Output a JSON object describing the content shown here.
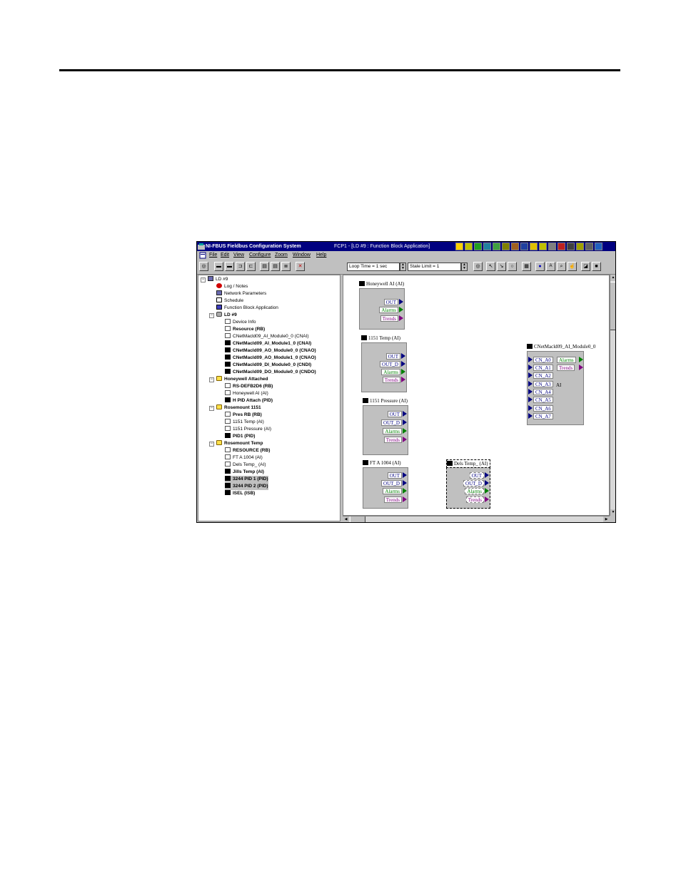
{
  "window": {
    "app_title": "NI-FBUS Fieldbus Configuration System",
    "doc_title": "FCP1 - [LD #9 : Function Block Application]"
  },
  "menu": [
    "File",
    "Edit",
    "View",
    "Configure",
    "Zoom",
    "Window",
    "Help"
  ],
  "toolbar": {
    "loop_time": "Loop Time = 1 sec",
    "stale_limit": "Stale Limit = 1"
  },
  "tree": {
    "root": "LD #9",
    "items": [
      "Log / Notes",
      "Network Parameters",
      "Schedule",
      "Function Block Application",
      "LD #9",
      "Device Info",
      "Resource (RB)",
      "CNetMacld09_AI_Module0_0 (CNAI)",
      "CNetMacld09_AI_Module1_0 (CNAI)",
      "CNetMacld09_AO_Module0_0 (CNAO)",
      "CNetMacld09_AO_Module1_0 (CNAO)",
      "CNetMacld09_DI_Module0_0 (CNDI)",
      "CNetMacld09_DO_Module0_0 (CNDO)",
      "Honeywell Attached",
      "RS-DEFB2D6 (RB)",
      "Honeywell AI (AI)",
      "H PID Attach (PID)",
      "Rosemount 1151",
      "Pres RB (RB)",
      "1151 Temp (AI)",
      "1151 Pressure (AI)",
      "PID1 (PID)",
      "Rosemount Temp",
      "RESOURCE (RB)",
      "FT A 1004 (AI)",
      "Dels Temp_ (AI)",
      "Jills Temp (AI)",
      "3244 PID 1 (PID)",
      "3244 PID 2 (PID)",
      "ISEL (ISB)"
    ]
  },
  "blocks": {
    "b1": {
      "title": "Honeywell AI (AI)",
      "ports": [
        "OUT",
        "Alarms",
        "Trends"
      ]
    },
    "b2": {
      "title": "1151 Temp (AI)",
      "ports": [
        "OUT",
        "OUT_D",
        "Alarms",
        "Trends"
      ]
    },
    "b3": {
      "title": "1151 Pressure (AI)",
      "ports": [
        "OUT",
        "OUT_D",
        "Alarms",
        "Trends"
      ]
    },
    "b4": {
      "title": "FT A 1004 (AI)",
      "ports": [
        "OUT",
        "OUT_D",
        "Alarms",
        "Trends"
      ]
    },
    "b5": {
      "title": "Dels Temp_ (AI)",
      "ports": [
        "OUT",
        "OUT_D",
        "Alarms",
        "Trends"
      ]
    },
    "b6": {
      "title": "CNetMacld09_AI_Module0_0",
      "inputs": [
        "CN_A0",
        "CN_A1",
        "CN_A2",
        "CN_A3",
        "CN_A4",
        "CN_A5",
        "CN_A6",
        "CN_A7"
      ],
      "outputs": [
        "Alarms",
        "Trends"
      ],
      "label": "AI"
    }
  },
  "colors": {
    "titlebar": "#000080",
    "out_port": "#000080",
    "alarms_port": "#008000",
    "trends_port": "#800080"
  }
}
